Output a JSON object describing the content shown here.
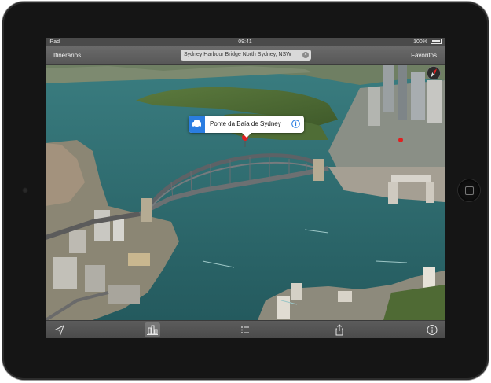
{
  "status_bar": {
    "device": "iPad",
    "time": "09:41",
    "battery": "100%"
  },
  "nav_bar": {
    "left_button": "Itinerários",
    "search_value": "Sydney Harbour Bridge North Sydney, NSW",
    "right_button": "Favoritos"
  },
  "callout": {
    "title": "Ponte da Baía de Sydney",
    "icon_left": "car-icon",
    "icon_right": "info-icon"
  },
  "toolbar": {
    "items": [
      "location-arrow-icon",
      "3d-buildings-icon",
      "list-icon",
      "share-icon",
      "info-icon"
    ]
  },
  "colors": {
    "accent": "#2a7de1",
    "pin": "#e02020",
    "water": "#2f6b70"
  }
}
